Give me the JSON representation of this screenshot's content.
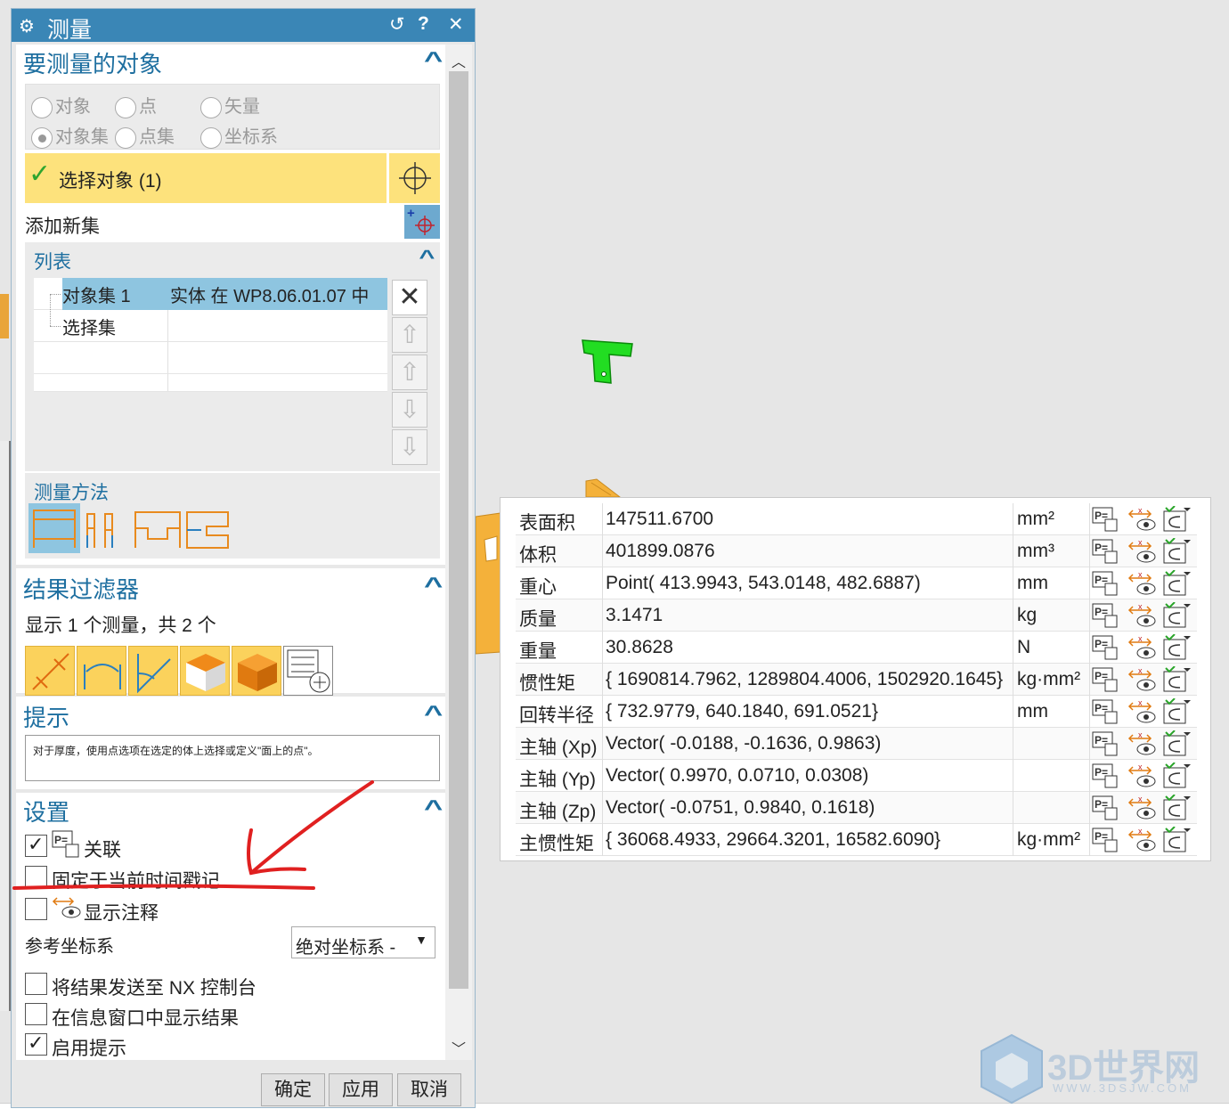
{
  "dialog": {
    "title": "测量",
    "sections": {
      "objects": {
        "title": "要测量的对象",
        "radios": [
          {
            "label": "对象",
            "checked": false
          },
          {
            "label": "点",
            "checked": false
          },
          {
            "label": "矢量",
            "checked": false
          },
          {
            "label": "对象集",
            "checked": true
          },
          {
            "label": "点集",
            "checked": false
          },
          {
            "label": "坐标系",
            "checked": false
          }
        ],
        "select_label": "选择对象 (1)",
        "add_set_label": "添加新集",
        "list": {
          "title": "列表",
          "rows": [
            {
              "name": "对象集 1",
              "value": "实体 在 WP8.06.01.07 中"
            },
            {
              "name": "选择集",
              "value": ""
            }
          ]
        },
        "method_title": "测量方法"
      },
      "filter": {
        "title": "结果过滤器",
        "summary": "显示 1 个测量，共 2 个"
      },
      "hint": {
        "title": "提示",
        "text": "对于厚度，使用点选项在选定的体上选择或定义\"面上的点\"。"
      },
      "settings": {
        "title": "设置",
        "associative": {
          "label": "关联",
          "checked": true
        },
        "fix_timestamp": {
          "label": "固定于当前时间戳记",
          "checked": false
        },
        "show_annotation": {
          "label": "显示注释",
          "checked": false
        },
        "ref_csys_label": "参考坐标系",
        "ref_csys_value": "绝对坐标系 -",
        "send_console": {
          "label": "将结果发送至 NX 控制台",
          "checked": false
        },
        "show_info": {
          "label": "在信息窗口中显示结果",
          "checked": false
        },
        "enable_hint": {
          "label": "启用提示",
          "checked": true
        }
      }
    },
    "buttons": {
      "ok": "确定",
      "apply": "应用",
      "cancel": "取消"
    }
  },
  "results": [
    {
      "name": "表面积",
      "value": "147511.6700",
      "unit": "mm²"
    },
    {
      "name": "体积",
      "value": "401899.0876",
      "unit": "mm³"
    },
    {
      "name": "重心",
      "value": "Point( 413.9943, 543.0148, 482.6887)",
      "unit": "mm"
    },
    {
      "name": "质量",
      "value": "3.1471",
      "unit": "kg"
    },
    {
      "name": "重量",
      "value": "30.8628",
      "unit": "N"
    },
    {
      "name": "惯性矩",
      "value": "{ 1690814.7962, 1289804.4006, 1502920.1645}",
      "unit": "kg·mm²"
    },
    {
      "name": "回转半径",
      "value": "{ 732.9779, 640.1840, 691.0521}",
      "unit": "mm"
    },
    {
      "name": "主轴 (Xp)",
      "value": "Vector( -0.0188, -0.1636, 0.9863)",
      "unit": ""
    },
    {
      "name": "主轴 (Yp)",
      "value": "Vector( 0.9970, 0.0710, 0.0308)",
      "unit": ""
    },
    {
      "name": "主轴 (Zp)",
      "value": "Vector( -0.0751, 0.9840, 0.1618)",
      "unit": ""
    },
    {
      "name": "主惯性矩",
      "value": "{ 36068.4933, 29664.3201, 16582.6090}",
      "unit": "kg·mm²"
    }
  ],
  "watermark": {
    "text": "3D世界网",
    "url": "WWW.3DSJW.COM"
  },
  "colors": {
    "accent": "#3a86b6",
    "select_highlight": "#fde27c",
    "part_green": "#22dd22",
    "part_orange": "#f4b13a",
    "annotation_red": "#e02020"
  }
}
